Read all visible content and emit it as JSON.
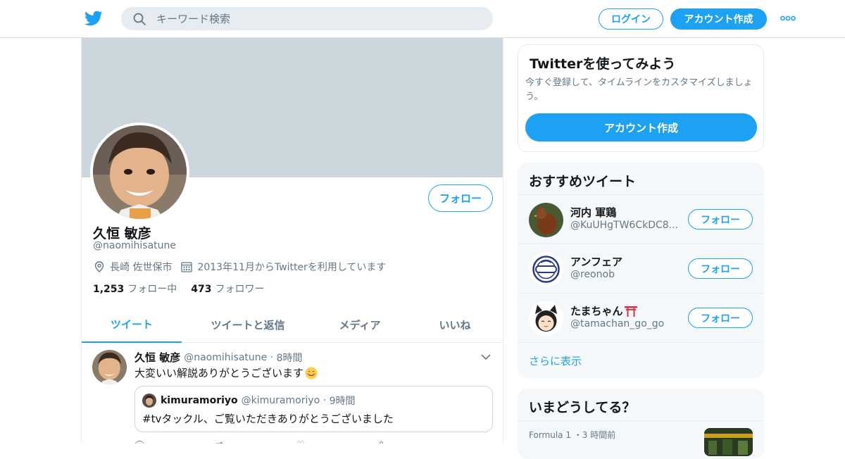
{
  "topbar": {
    "search_placeholder": "キーワード検索",
    "login_label": "ログイン",
    "signup_label": "アカウント作成",
    "more_icon": "more-dots-icon",
    "brand_color": "#1da1f2"
  },
  "profile": {
    "name": "久恒 敏彦",
    "handle": "@naomihisatune",
    "follow_label": "フォロー",
    "location": "長崎 佐世保市",
    "joined": "2013年11月からTwitterを利用しています",
    "following_count": "1,253",
    "following_label": "フォロー中",
    "followers_count": "473",
    "followers_label": "フォロワー",
    "banner_color": "#ccd6dd"
  },
  "tabs": [
    {
      "label": "ツイート",
      "active": true
    },
    {
      "label": "ツイートと返信",
      "active": false
    },
    {
      "label": "メディア",
      "active": false
    },
    {
      "label": "いいね",
      "active": false
    }
  ],
  "tweet": {
    "author_name": "久恒 敏彦",
    "author_handle": "@naomihisatune",
    "time": "8時間",
    "text": "大変いい解説ありがとうございます",
    "quote": {
      "author_name": "kimuramoriyo",
      "author_handle": "@kimuramoriyo",
      "time": "9時間",
      "text": "#tvタックル、ご覧いただきありがとうございました"
    }
  },
  "signup_card": {
    "title": "Twitterを使ってみよう",
    "description": "今すぐ登録して、タイムラインをカスタマイズしましょう。",
    "button_label": "アカウント作成"
  },
  "recommend_card": {
    "title": "おすすめツイート",
    "follow_label": "フォロー",
    "accounts": [
      {
        "name": "河内 軍鶏",
        "handle": "@KuUHgTW6CkDC8..."
      },
      {
        "name": "アンフェア",
        "handle": "@reonob"
      },
      {
        "name": "たまちゃん",
        "handle": "@tamachan_go_go"
      }
    ],
    "show_more": "さらに表示"
  },
  "trends_card": {
    "title": "いまどうしてる？",
    "first_meta": "Formula 1 ・3 時間前"
  }
}
